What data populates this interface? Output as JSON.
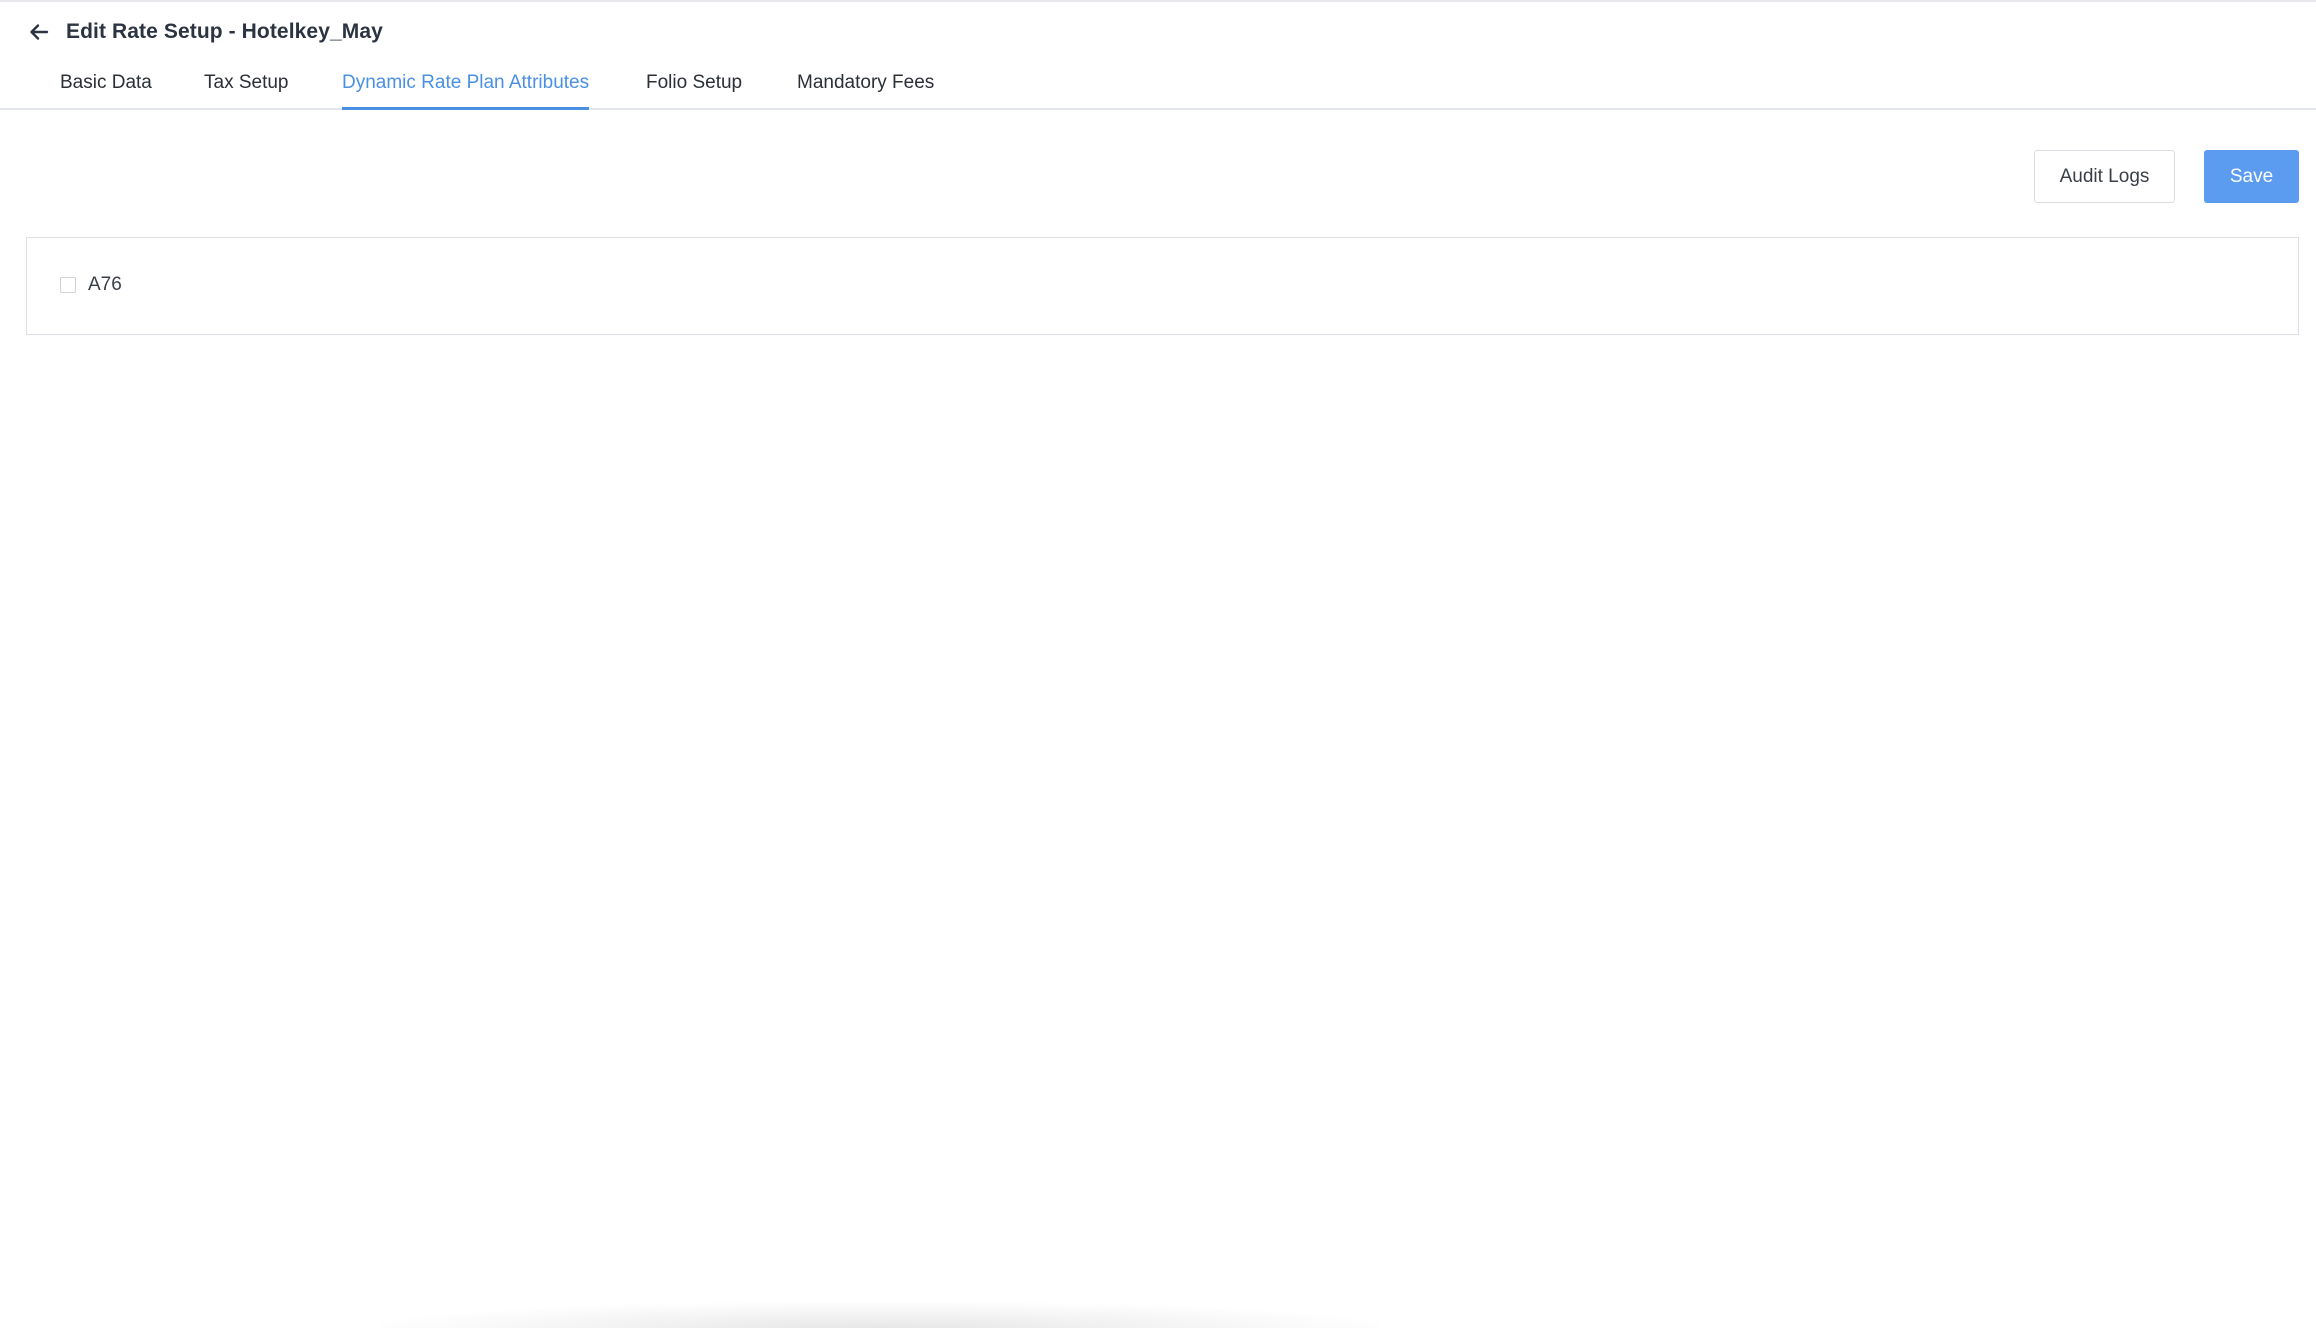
{
  "header": {
    "back_icon": "arrow-left-icon",
    "title": "Edit Rate Setup - Hotelkey_May"
  },
  "tabs": [
    {
      "label": "Basic Data",
      "active": false
    },
    {
      "label": "Tax Setup",
      "active": false
    },
    {
      "label": "Dynamic Rate Plan Attributes",
      "active": true
    },
    {
      "label": "Folio Setup",
      "active": false
    },
    {
      "label": "Mandatory Fees",
      "active": false
    }
  ],
  "toolbar": {
    "audit_logs_label": "Audit Logs",
    "save_label": "Save"
  },
  "attributes": {
    "items": [
      {
        "label": "A76",
        "checked": false
      }
    ]
  },
  "colors": {
    "accent": "#4a90e2",
    "save_button": "#5b9cf0",
    "border": "#dcdfe3"
  }
}
